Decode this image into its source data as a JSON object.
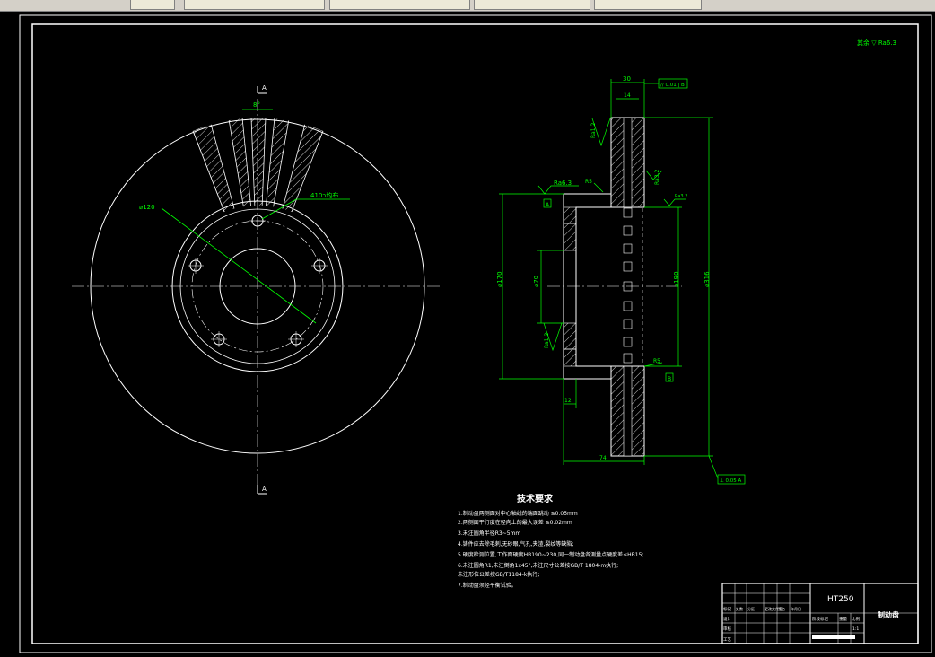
{
  "window": {
    "tabs": [
      "",
      "",
      "",
      ""
    ]
  },
  "front_view": {
    "section_marker_top": "A",
    "section_marker_bottom": "A",
    "angle_label": "8°",
    "pcd_label": "⌀120",
    "hole_label": "4ר10均布"
  },
  "side_view": {
    "dim_top_30": "30",
    "dim_top_inner": "14",
    "flatness_box": "// 0.01 | B",
    "rough_ra_left": "Ra1.2",
    "rough_ra_right": "Ra3.2",
    "rough_ra_flange": "Ra6.3",
    "rough_ra_small": "Ra3.2",
    "rough_ra_inner": "Ra1.2",
    "dia_170": "⌀170",
    "dia_70": "⌀70",
    "dia_190": "⌀190",
    "dia_316": "⌀316",
    "datum_a": "A",
    "datum_b": "B",
    "chamfer_b5_top": "R5",
    "chamfer_b5_bottom": "R5",
    "dim_bottom_12": "12",
    "dim_bottom_74": "74",
    "perp_box": "⊥ 0.05 A"
  },
  "corner": {
    "rough_other": "其余 ▽ Ra6.3"
  },
  "notes": {
    "title": "技术要求",
    "items": [
      "1.制动盘两侧面对中心轴线的端面跳动 ≤0.05mm",
      "2.两侧面平行度在径向上的最大误差 ≤0.02mm",
      "3.未注圆角半径R3~5mm",
      "4.铸件应去除毛刺,无砂眼,气孔,夹渣,裂纹等缺陷;",
      "5.硬度检测位置,工作面硬度HB190~230,同一制动盘各测量点硬度差≤HB15;",
      "6.未注圆角R1,未注倒角1x45°,未注尺寸公差按GB/T 1804-m执行;",
      "  未注形位公差按GB/T1184-k执行;",
      "7.制动盘须经平衡试验。"
    ]
  },
  "title_block": {
    "material": "HT250",
    "part_name": "制动盘",
    "rows": [
      "标记",
      "设计",
      "审核",
      "工艺"
    ],
    "cols": [
      "处数",
      "分区",
      "更改文件号",
      "签名",
      "年月日"
    ],
    "scale_labels": [
      "阶段标记",
      "重量",
      "比例"
    ],
    "scale_value": "1:1"
  }
}
